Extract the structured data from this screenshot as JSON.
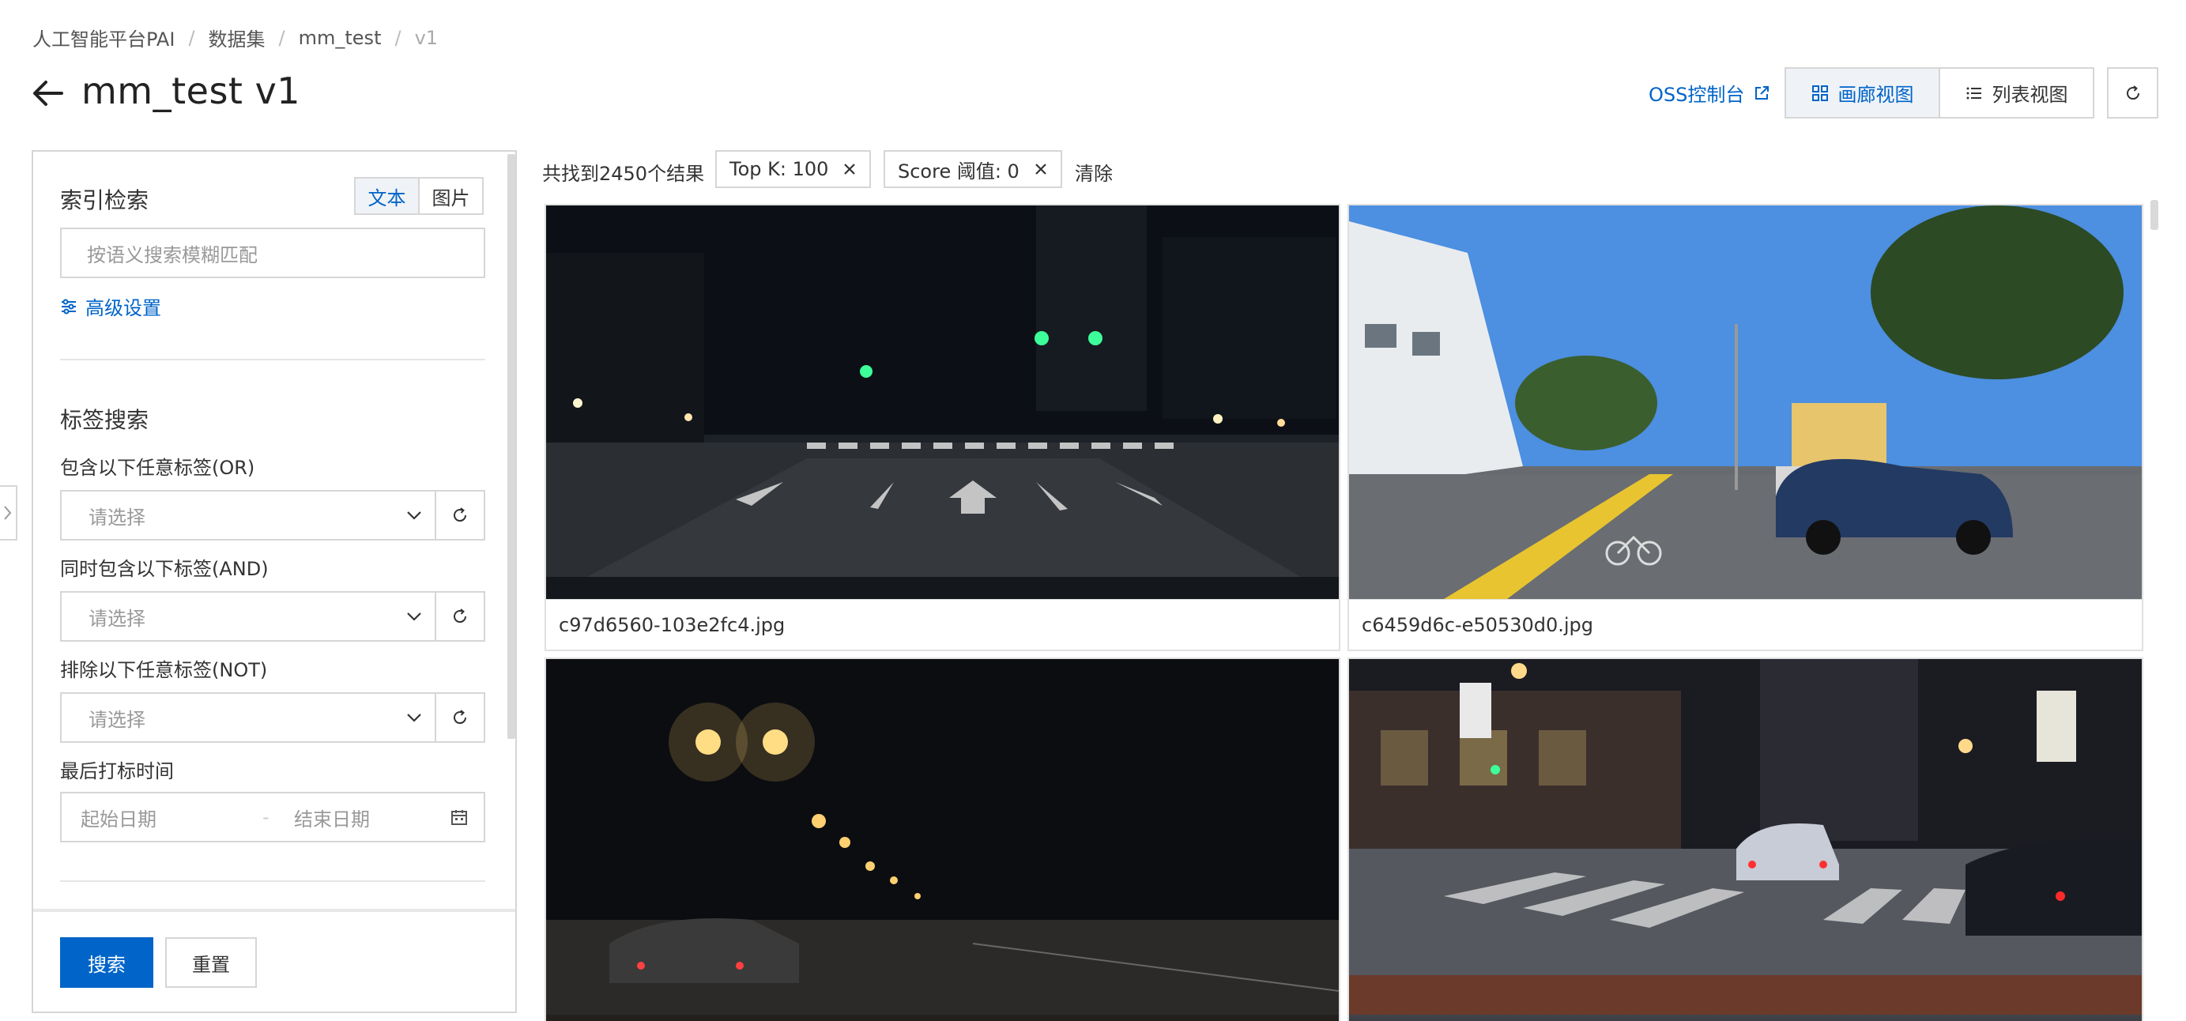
{
  "breadcrumb": [
    "人工智能平台PAI",
    "数据集",
    "mm_test",
    "v1"
  ],
  "header": {
    "title": "mm_test v1",
    "oss_link": "OSS控制台",
    "view_gallery": "画廊视图",
    "view_list": "列表视图"
  },
  "left_panel": {
    "index_search": {
      "title": "索引检索",
      "mode_text": "文本",
      "mode_image": "图片",
      "placeholder": "按语义搜索模糊匹配",
      "advanced": "高级设置"
    },
    "tag_search": {
      "title": "标签搜索",
      "or_label": "包含以下任意标签(OR)",
      "and_label": "同时包含以下标签(AND)",
      "not_label": "排除以下任意标签(NOT)",
      "select_placeholder": "请选择",
      "last_tag_time": "最后打标时间",
      "start_date": "起始日期",
      "end_date": "结束日期"
    },
    "search_button": "搜索",
    "reset_button": "重置"
  },
  "results": {
    "count_text": "共找到2450个结果",
    "chip_topk": "Top K: 100",
    "chip_score": "Score 阈值: 0",
    "clear": "清除",
    "items": [
      {
        "filename": "c97d6560-103e2fc4.jpg"
      },
      {
        "filename": "c6459d6c-e50530d0.jpg"
      },
      {
        "filename": ""
      },
      {
        "filename": ""
      }
    ]
  },
  "colors": {
    "accent": "#0064c8",
    "border": "#d6d6d6"
  }
}
